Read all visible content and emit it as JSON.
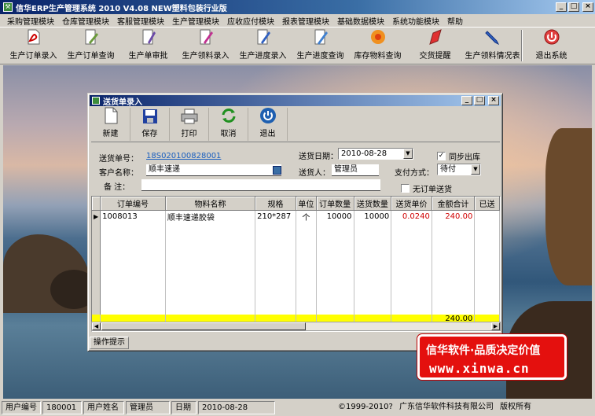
{
  "window": {
    "title": "信华ERP生产管理系统  2010 V4.08 NEW塑料包装行业版"
  },
  "menu": [
    "采购管理模块",
    "仓库管理模块",
    "客服管理模块",
    "生产管理模块",
    "应收应付模块",
    "报表管理模块",
    "基础数据模块",
    "系统功能模块",
    "帮助"
  ],
  "toolbar": [
    {
      "label": "生产订单录入",
      "icon": "pdf-form-icon"
    },
    {
      "label": "生产订单查询",
      "icon": "document-pen-icon"
    },
    {
      "label": "生产单审批",
      "icon": "document-check-icon"
    },
    {
      "label": "生产领料录入",
      "icon": "document-red-icon"
    },
    {
      "label": "生产进度录入",
      "icon": "document-blue-icon"
    },
    {
      "label": "生产进度查询",
      "icon": "document-pencil-icon"
    },
    {
      "label": "库存物料查询",
      "icon": "flower-icon"
    },
    {
      "label": "交货提醒",
      "icon": "pen-red-icon"
    },
    {
      "label": "生产领料情况表",
      "icon": "pen-blue-icon"
    },
    {
      "label": "退出系统",
      "icon": "exit-circle-icon"
    }
  ],
  "child": {
    "title": "送货单录入",
    "toolbar": [
      {
        "label": "新建",
        "icon": "new-document-icon"
      },
      {
        "label": "保存",
        "icon": "save-disk-icon"
      },
      {
        "label": "打印",
        "icon": "printer-icon"
      },
      {
        "label": "取消",
        "icon": "undo-arrows-icon"
      },
      {
        "label": "退出",
        "icon": "power-icon"
      }
    ],
    "form": {
      "delivery_no_label": "送货单号：",
      "delivery_no": "18S020100828001",
      "delivery_date_label": "送货日期：",
      "delivery_date": "2010-08-28",
      "sync_out_label": "同步出库",
      "sync_out_checked": true,
      "customer_label": "客户名称：",
      "customer": "顺丰速递",
      "deliverer_label": "送货人：",
      "deliverer": "管理员",
      "payment_label": "支付方式：",
      "payment": "待付",
      "remark_label": "备 注：",
      "remark": "",
      "no_order_label": "无订单送货",
      "no_order_checked": false
    },
    "grid": {
      "columns": [
        "订单编号",
        "物料名称",
        "规格",
        "单位",
        "订单数量",
        "送货数量",
        "送货单价",
        "金额合计",
        "已送"
      ],
      "rows": [
        {
          "order_no": "1008013",
          "material": "顺丰速递胶袋",
          "spec": "210*287",
          "unit": "个",
          "order_qty": "10000",
          "deliver_qty": "10000",
          "price": "0.0240",
          "amount": "240.00",
          "delivered": ""
        }
      ],
      "total_amount": "240.00"
    },
    "hint_tab": "操作提示"
  },
  "promo": {
    "line1": "信华软件·品质决定价值",
    "line2": "www.xinwa.cn"
  },
  "statusbar": {
    "user_no_label": "用户编号",
    "user_no": "180001",
    "user_name_label": "用户姓名",
    "user_name": "管理员",
    "date_label": "日期",
    "date": "2010-08-28",
    "copyright": "©1999-2010?",
    "company": "广东信华软件科技有限公司",
    "rights": "版权所有"
  }
}
